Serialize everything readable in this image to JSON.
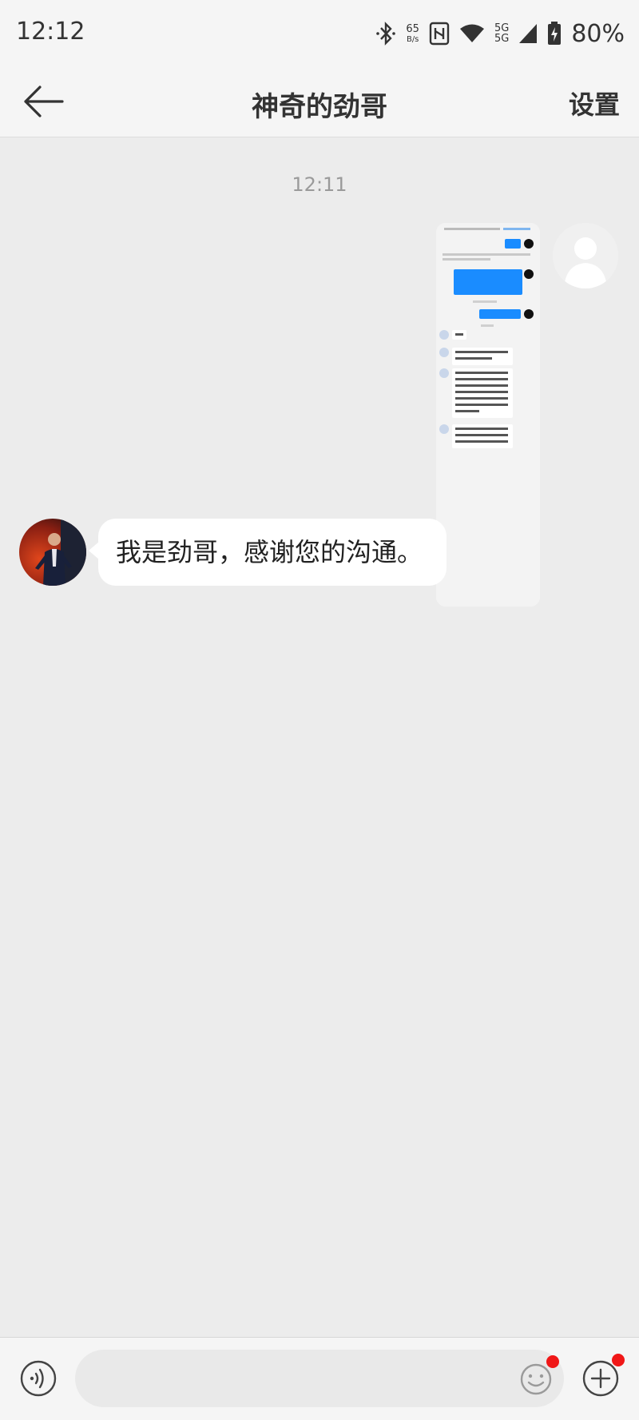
{
  "status_bar": {
    "time": "12:12",
    "speed_value": "65",
    "speed_unit": "B/s",
    "net_top": "5G",
    "net_bottom": "5G",
    "battery": "80%"
  },
  "header": {
    "title": "神奇的劲哥",
    "settings_label": "设置"
  },
  "chat": {
    "timestamp": "12:11",
    "messages": [
      {
        "from": "me",
        "kind": "image",
        "content": "screenshot of a previous chat conversation"
      },
      {
        "from": "other",
        "kind": "text",
        "text": "我是劲哥，感谢您的沟通。"
      }
    ]
  },
  "input": {
    "placeholder": "",
    "emoji_badge": true,
    "plus_badge": true
  },
  "colors": {
    "background": "#ececec",
    "bar_background": "#f5f5f5",
    "bubble": "#ffffff",
    "badge": "#f01717",
    "thumbnail_blue": "#1a8cff"
  },
  "icons": [
    "bluetooth-icon",
    "nfc-icon",
    "wifi-icon",
    "signal-icon",
    "battery-icon",
    "back-arrow-icon",
    "voice-icon",
    "emoji-icon",
    "plus-icon"
  ]
}
